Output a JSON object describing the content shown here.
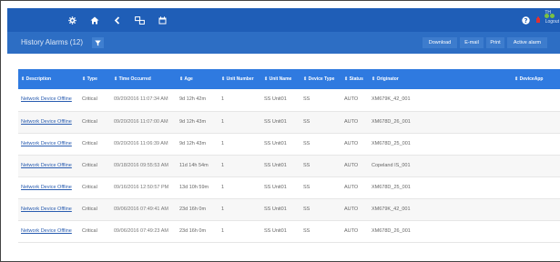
{
  "navbar": {
    "icons": [
      "gear-icon",
      "home-icon",
      "back-icon",
      "network-icon",
      "calendar-icon",
      "help-icon",
      "alarm-icon"
    ],
    "user": "TH",
    "logout_label": "Logout",
    "alarm_colors": [
      "#e03030",
      "#7bc142",
      "#7bc142"
    ],
    "bar_color": "#1f5eb7"
  },
  "titlebar": {
    "title": "History Alarms (12)",
    "filter_icon": "filter-icon",
    "buttons": [
      "Download",
      "E-mail",
      "Print",
      "Active alarm"
    ]
  },
  "table": {
    "header_color": "#2f7ae0",
    "columns": [
      "⇕ Description",
      "⇕ Type",
      "⇕ Time Occurred",
      "⇕ Age",
      "⇕ Unit Number",
      "⇕ Unit Name",
      "⇕ Device Type",
      "⇕ Status",
      "⇕ Originator",
      "⇕ DeviceApp"
    ],
    "rows": [
      {
        "description": "Network Device Offline",
        "type": "Critical",
        "time": "09/20/2016 11:07:34 AM",
        "age": "9d 12h 42m",
        "unit_number": "1",
        "unit_name": "SS Unit01",
        "device_type": "SS",
        "status": "AUTO",
        "originator": "XM679K_42_001",
        "device_app": ""
      },
      {
        "description": "Network Device Offline",
        "type": "Critical",
        "time": "09/20/2016 11:07:00 AM",
        "age": "9d 12h 43m",
        "unit_number": "1",
        "unit_name": "SS Unit01",
        "device_type": "SS",
        "status": "AUTO",
        "originator": "XM678D_26_001",
        "device_app": ""
      },
      {
        "description": "Network Device Offline",
        "type": "Critical",
        "time": "09/20/2016 11:06:39 AM",
        "age": "9d 12h 43m",
        "unit_number": "1",
        "unit_name": "SS Unit01",
        "device_type": "SS",
        "status": "AUTO",
        "originator": "XM678D_25_001",
        "device_app": ""
      },
      {
        "description": "Network Device Offline",
        "type": "Critical",
        "time": "09/18/2016 09:55:53 AM",
        "age": "11d 14h 54m",
        "unit_number": "1",
        "unit_name": "SS Unit01",
        "device_type": "SS",
        "status": "AUTO",
        "originator": "Copeland IS_001",
        "device_app": ""
      },
      {
        "description": "Network Device Offline",
        "type": "Critical",
        "time": "09/16/2016 12:50:57 PM",
        "age": "13d 10h 59m",
        "unit_number": "1",
        "unit_name": "SS Unit01",
        "device_type": "SS",
        "status": "AUTO",
        "originator": "XM678D_25_001",
        "device_app": ""
      },
      {
        "description": "Network Device Offline",
        "type": "Critical",
        "time": "09/06/2016 07:49:41 AM",
        "age": "23d 16h 0m",
        "unit_number": "1",
        "unit_name": "SS Unit01",
        "device_type": "SS",
        "status": "AUTO",
        "originator": "XM679K_42_001",
        "device_app": ""
      },
      {
        "description": "Network Device Offline",
        "type": "Critical",
        "time": "09/06/2016 07:49:23 AM",
        "age": "23d 16h 0m",
        "unit_number": "1",
        "unit_name": "SS Unit01",
        "device_type": "SS",
        "status": "AUTO",
        "originator": "XM678D_26_001",
        "device_app": ""
      }
    ]
  }
}
